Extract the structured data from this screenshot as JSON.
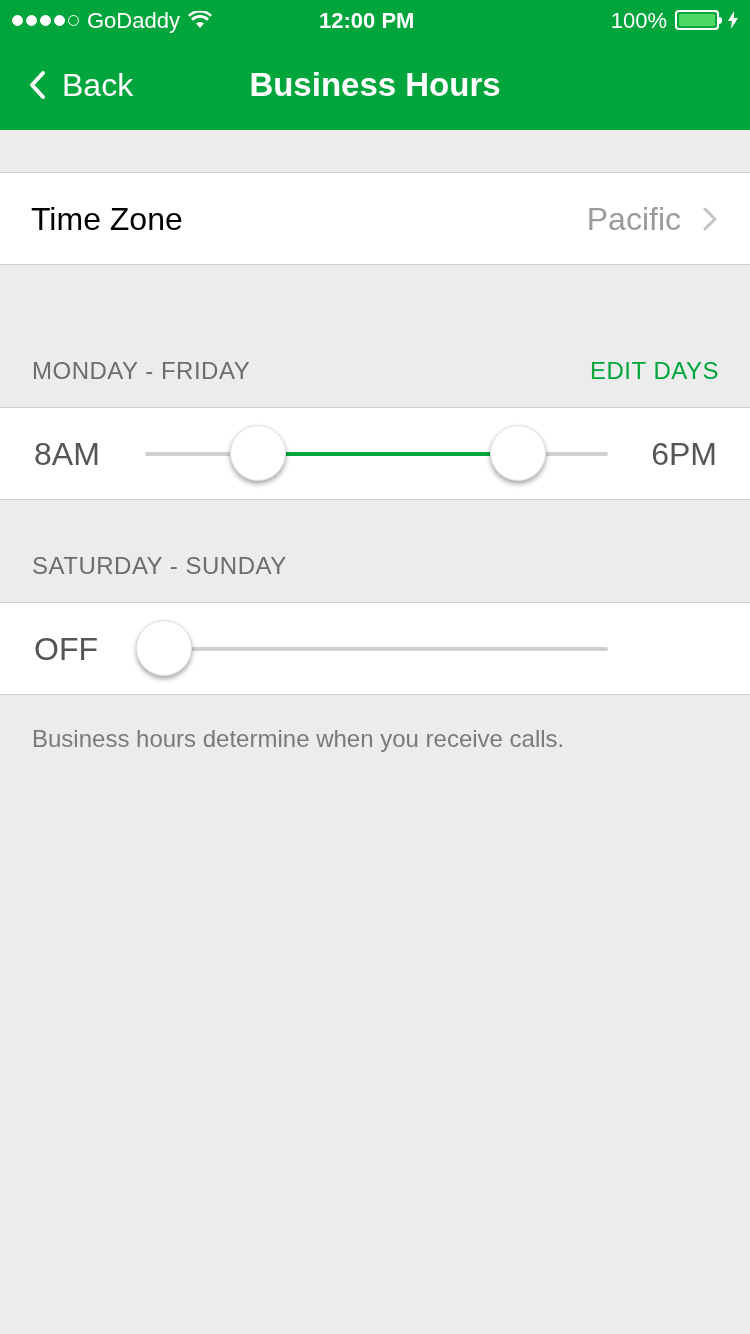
{
  "status_bar": {
    "carrier": "GoDaddy",
    "time": "12:00 PM",
    "battery": "100%"
  },
  "nav": {
    "back": "Back",
    "title": "Business Hours"
  },
  "time_zone": {
    "label": "Time Zone",
    "value": "Pacific"
  },
  "sections": [
    {
      "header": "MONDAY - FRIDAY",
      "action": "EDIT DAYS",
      "kind": "range",
      "start_label": "8AM",
      "end_label": "6PM",
      "thumbs": [
        {
          "level": 0.244
        },
        {
          "level": 0.806
        }
      ]
    },
    {
      "header": "SATURDAY - SUNDAY",
      "kind": "off",
      "start_label": "OFF",
      "thumbs": [
        {
          "level": 0.04
        }
      ]
    }
  ],
  "footer": "Business hours determine when you receive calls."
}
